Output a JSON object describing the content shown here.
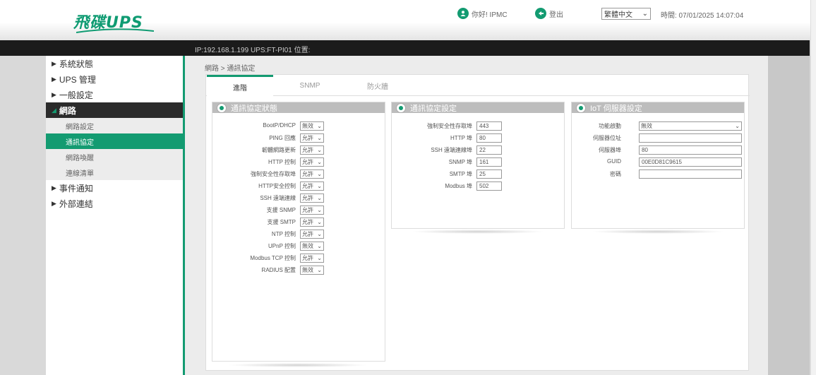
{
  "header": {
    "logo_text": "飛碟UPS",
    "greeting": "你好! IPMC",
    "logout": "登出",
    "language": "繁體中文",
    "time": "時間: 07/01/2025 14:07:04"
  },
  "ipbar": {
    "text": "IP:192.168.1.199    UPS:FT-PI01    位置:"
  },
  "sidebar": {
    "items": [
      {
        "label": "系統狀態"
      },
      {
        "label": "UPS 管理"
      },
      {
        "label": "一般設定"
      },
      {
        "label": "網路"
      },
      {
        "label": "事件通知"
      },
      {
        "label": "外部連結"
      }
    ],
    "subitems": [
      {
        "label": "網路設定"
      },
      {
        "label": "通訊協定"
      },
      {
        "label": "網路喚醒"
      },
      {
        "label": "連線清單"
      }
    ]
  },
  "breadcrumb": "網路 > 通訊協定",
  "tabs": [
    {
      "label": "進階"
    },
    {
      "label": "SNMP"
    },
    {
      "label": "防火牆"
    }
  ],
  "status_box": {
    "title": "通訊協定狀態",
    "rows": [
      {
        "label": "BootP/DHCP",
        "value": "無效"
      },
      {
        "label": "PING 回應",
        "value": "允許"
      },
      {
        "label": "韌體網路更新",
        "value": "允許"
      },
      {
        "label": "HTTP 控制",
        "value": "允許"
      },
      {
        "label": "強制安全性存取埠",
        "value": "允許"
      },
      {
        "label": "HTTP安全控制",
        "value": "允許"
      },
      {
        "label": "SSH 遠端連線",
        "value": "允許"
      },
      {
        "label": "支援 SNMP",
        "value": "允許"
      },
      {
        "label": "支援 SMTP",
        "value": "允許"
      },
      {
        "label": "NTP 控制",
        "value": "允許"
      },
      {
        "label": "UPnP 控制",
        "value": "無效"
      },
      {
        "label": "Modbus TCP 控制",
        "value": "允許"
      },
      {
        "label": "RADIUS 配置",
        "value": "無效"
      }
    ]
  },
  "settings_box": {
    "title": "通訊協定設定",
    "rows": [
      {
        "label": "強制安全性存取埠",
        "value": "443"
      },
      {
        "label": "HTTP 埠",
        "value": "80"
      },
      {
        "label": "SSH 遠端連線埠",
        "value": "22"
      },
      {
        "label": "SNMP 埠",
        "value": "161"
      },
      {
        "label": "SMTP 埠",
        "value": "25"
      },
      {
        "label": "Modbus 埠",
        "value": "502"
      }
    ]
  },
  "iot_box": {
    "title": "IoT 伺服器設定",
    "rows": [
      {
        "label": "功能啟動",
        "value": "無效"
      },
      {
        "label": "伺服器位址",
        "value": ""
      },
      {
        "label": "伺服器埠",
        "value": "80"
      },
      {
        "label": "GUID",
        "value": "00E0D81C9615"
      },
      {
        "label": "密碼",
        "value": ""
      }
    ]
  },
  "colors": {
    "accent": "#139b71",
    "dark": "#1b1b1b",
    "panel_header": "#bdbdbd"
  },
  "icons": {
    "user": "user-circle-icon",
    "logout": "logout-icon",
    "collapse": "double-chevron-left-icon"
  }
}
